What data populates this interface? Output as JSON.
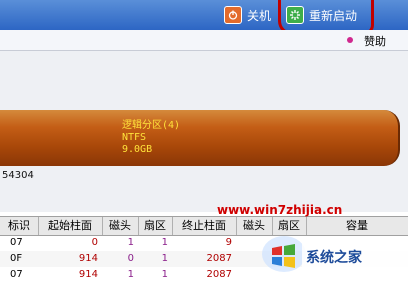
{
  "toolbar": {
    "shutdown_label": "关机",
    "restart_label": "重新启动"
  },
  "subbar": {
    "donate_label": "赞助"
  },
  "disk": {
    "partition_name": "逻辑分区(4)",
    "filesystem": "NTFS",
    "size": "9.0GB",
    "color": "#b8540f"
  },
  "sector_number": "54304",
  "table": {
    "headers": [
      "标识",
      "起始柱面",
      "磁头",
      "扇区",
      "终止柱面",
      "磁头",
      "扇区",
      "容量"
    ],
    "rows": [
      [
        "07",
        "0",
        "1",
        "1",
        "9",
        "",
        "",
        ""
      ],
      [
        "0F",
        "914",
        "0",
        "1",
        "2087",
        "",
        "",
        ""
      ],
      [
        "07",
        "914",
        "1",
        "1",
        "2087",
        "",
        "",
        ""
      ]
    ]
  },
  "watermark": {
    "url": "www.win7zhijia.cn",
    "brand": "系统之家"
  }
}
